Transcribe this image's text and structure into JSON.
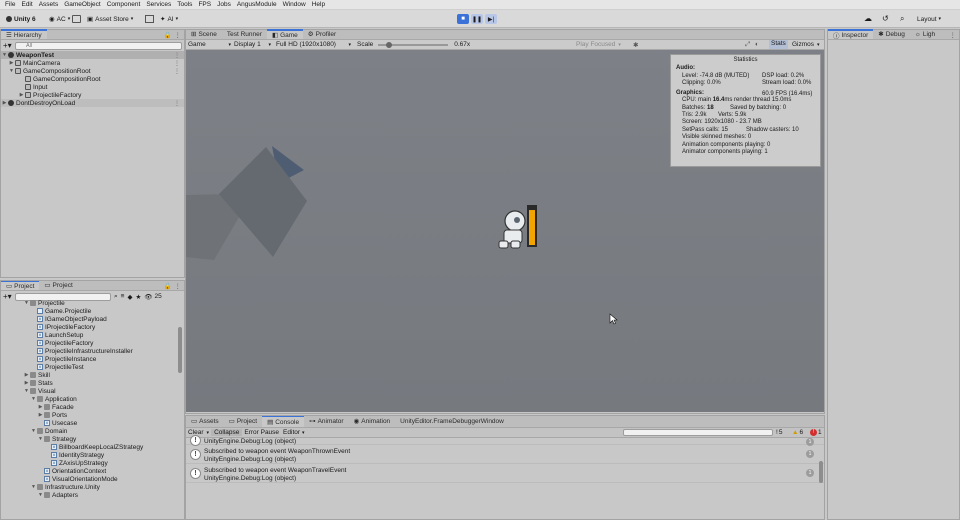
{
  "menubar": [
    "File",
    "Edit",
    "Assets",
    "GameObject",
    "Component",
    "Services",
    "Tools",
    "FPS",
    "Jobs",
    "AngusModule",
    "Window",
    "Help"
  ],
  "toolbar": {
    "unity_label": "Unity 6",
    "account_label": "AC",
    "asset_store_label": "Asset Store",
    "ai_label": "AI",
    "layout_label": "Layout"
  },
  "hierarchy": {
    "tab": "Hierarchy",
    "search_placeholder": "All",
    "items": [
      {
        "label": "WeaponTest"
      },
      {
        "label": "MainCamera"
      },
      {
        "label": "GameCompositionRoot"
      },
      {
        "label": "GameCompositionRoot"
      },
      {
        "label": "Input"
      },
      {
        "label": "ProjectileFactory"
      },
      {
        "label": "DontDestroyOnLoad"
      }
    ]
  },
  "project": {
    "tab_project1": "Project",
    "tab_project2": "Project",
    "count": "25",
    "items": [
      {
        "label": "Projectile"
      },
      {
        "label": "Game.Projectile"
      },
      {
        "label": "IGameObjectPayload"
      },
      {
        "label": "IProjectileFactory"
      },
      {
        "label": "LaunchSetup"
      },
      {
        "label": "ProjectileFactory"
      },
      {
        "label": "ProjectileInfrastructureInstaller"
      },
      {
        "label": "ProjectileInstance"
      },
      {
        "label": "ProjectileTest"
      },
      {
        "label": "Skill"
      },
      {
        "label": "Stats"
      },
      {
        "label": "Visual"
      },
      {
        "label": "Application"
      },
      {
        "label": "Facade"
      },
      {
        "label": "Ports"
      },
      {
        "label": "Usecase"
      },
      {
        "label": "Domain"
      },
      {
        "label": "Strategy"
      },
      {
        "label": "BillboardKeepLocalZStrategy"
      },
      {
        "label": "IdentityStrategy"
      },
      {
        "label": "ZAxisUpStrategy"
      },
      {
        "label": "OrientationContext"
      },
      {
        "label": "VisualOrientationMode"
      },
      {
        "label": "Infrastructure.Unity"
      },
      {
        "label": "Adapters"
      }
    ]
  },
  "center_tabs": {
    "scene": "Scene",
    "test_runner": "Test Runner",
    "game": "Game",
    "profiler": "Profiler"
  },
  "game_toolbar": {
    "mode": "Game",
    "display": "Display 1",
    "resolution": "Full HD (1920x1080)",
    "scale_label": "Scale",
    "scale_value": "0.67x",
    "play_focused": "Play Focused",
    "stats_label": "Stats",
    "gizmos_label": "Gizmos",
    "scale_fraction": 0.12
  },
  "stats": {
    "title": "Statistics",
    "audio_heading": "Audio:",
    "level": "Level: -74.8 dB (MUTED)",
    "clipping": "Clipping: 0.0%",
    "dsp_load": "DSP load: 0.2%",
    "stream_load": "Stream load: 0.0%",
    "graphics_heading": "Graphics:",
    "fps": "60.9 FPS (16.4ms)",
    "cpu_prefix": "CPU: main",
    "cpu_main": "16.4",
    "cpu_suffix": "ms  render thread 15.0ms",
    "batches_prefix": "Batches:",
    "batches_value": "18",
    "saved_batching": "Saved by batching: 0",
    "tris": "Tris: 2.9k",
    "verts": "Verts: 5.9k",
    "screen": "Screen: 1920x1080 - 23.7 MB",
    "setpass": "SetPass calls: 15",
    "shadow_casters": "Shadow casters: 10",
    "skinned_meshes": "Visible skinned meshes: 0",
    "anim_components": "Animation components playing: 0",
    "animator_components": "Animator components playing: 1"
  },
  "character": {
    "health_fraction": 0.92
  },
  "bottom_tabs": {
    "assets": "Assets",
    "project": "Project",
    "console": "Console",
    "animator1": "Animator",
    "animation": "Animation",
    "frame_debugger": "UnityEditor.FrameDebuggerWindow"
  },
  "console": {
    "clear": "Clear",
    "collapse": "Collapse",
    "error_pause": "Error Pause",
    "editor": "Editor",
    "log_count": "5",
    "warn_count": "6",
    "error_count": "1",
    "entries": [
      {
        "line1": "UnityEngine.Debug:Log (object)",
        "line2": ""
      },
      {
        "line1": "Subscribed to weapon event WeaponThrownEvent",
        "line2": "UnityEngine.Debug:Log (object)"
      },
      {
        "line1": "Subscribed to weapon event WeaponTravelEvent",
        "line2": "UnityEngine.Debug:Log (object)"
      }
    ],
    "entry_badge": "1"
  },
  "right_tabs": {
    "inspector": "Inspector",
    "debug": "Debug",
    "lighting": "Ligh"
  },
  "colors": {
    "accent": "#3a72d8",
    "game_bg": "#797e83",
    "health_fill": "#f2a400"
  }
}
